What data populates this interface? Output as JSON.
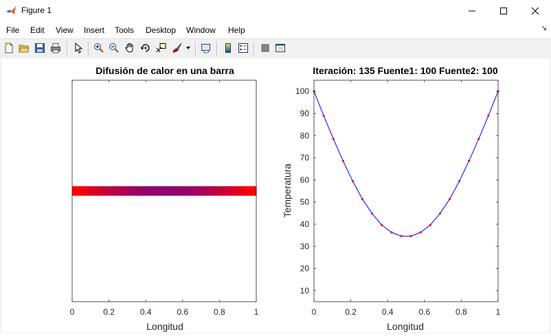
{
  "window": {
    "title": "Figure 1",
    "controls": [
      "minimize",
      "maximize",
      "close"
    ]
  },
  "menu": {
    "items": [
      "File",
      "Edit",
      "View",
      "Insert",
      "Tools",
      "Desktop",
      "Window",
      "Help"
    ]
  },
  "toolbar": {
    "buttons": [
      "new-figure-icon",
      "open-file-icon",
      "save-icon",
      "print-icon",
      "edit-plot-arrow-icon",
      "zoom-in-icon",
      "zoom-out-icon",
      "pan-hand-icon",
      "rotate-3d-icon",
      "data-cursor-icon",
      "brush-icon",
      "link-plot-icon",
      "insert-colorbar-icon",
      "insert-legend-icon",
      "hide-plot-tools-icon",
      "show-plot-tools-icon"
    ]
  },
  "chart_data": [
    {
      "type": "heatmap",
      "title": "Difusión de calor en una barra",
      "xlabel": "Longitud",
      "ylabel": "",
      "xlim": [
        0,
        1
      ],
      "xticks": [
        "0",
        "0.2",
        "0.4",
        "0.6",
        "0.8",
        "1"
      ],
      "y_values": [
        0.5
      ],
      "colormap": "red-to-blue by temperature",
      "temperature_values": [
        100,
        89.0,
        78.5,
        68.6,
        59.4,
        51.3,
        44.8,
        39.6,
        36.3,
        34.6,
        34.6,
        36.3,
        39.6,
        44.8,
        51.3,
        59.4,
        68.6,
        78.5,
        89.0,
        100
      ]
    },
    {
      "type": "line",
      "title": "Iteración: 135 Fuente1: 100 Fuente2: 100",
      "xlabel": "Longitud",
      "ylabel": "Temperatura",
      "xlim": [
        0,
        1
      ],
      "ylim": [
        5,
        105
      ],
      "xticks": [
        "0",
        "0.2",
        "0.4",
        "0.6",
        "0.8",
        "1"
      ],
      "yticks": [
        "10",
        "20",
        "30",
        "40",
        "50",
        "60",
        "70",
        "80",
        "90",
        "100"
      ],
      "line_color": "#0000ff",
      "marker_color": "#ff0000",
      "x": [
        0,
        0.0526,
        0.1053,
        0.1579,
        0.2105,
        0.2632,
        0.3158,
        0.3684,
        0.4211,
        0.4737,
        0.5263,
        0.5789,
        0.6316,
        0.6842,
        0.7368,
        0.7895,
        0.8421,
        0.8947,
        0.9474,
        1
      ],
      "y": [
        100,
        89.0,
        78.5,
        68.6,
        59.4,
        51.3,
        44.8,
        39.6,
        36.3,
        34.6,
        34.6,
        36.3,
        39.6,
        44.8,
        51.3,
        59.4,
        68.6,
        78.5,
        89.0,
        100
      ]
    }
  ]
}
